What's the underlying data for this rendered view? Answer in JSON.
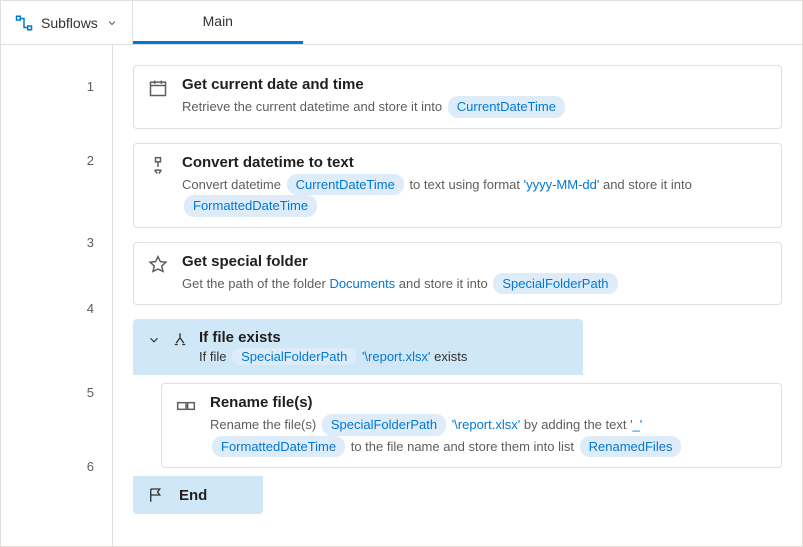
{
  "toolbar": {
    "subflows_label": "Subflows",
    "active_tab": "Main"
  },
  "lines": {
    "l1": "1",
    "l2": "2",
    "l3": "3",
    "l4": "4",
    "l5": "5",
    "l6": "6"
  },
  "actions": {
    "a1": {
      "title": "Get current date and time",
      "desc_pre": "Retrieve the current datetime and store it into ",
      "var1": "CurrentDateTime"
    },
    "a2": {
      "title": "Convert datetime to text",
      "d1": "Convert datetime ",
      "var1": "CurrentDateTime",
      "d2": " to text using format ",
      "fmt": "'yyyy-MM-dd'",
      "d3": " and store it into ",
      "var2": "FormattedDateTime"
    },
    "a3": {
      "title": "Get special folder",
      "d1": "Get the path of the folder ",
      "link": "Documents",
      "d2": " and store it into ",
      "var1": "SpecialFolderPath"
    },
    "ifh": {
      "title": "If file exists",
      "d1": "If file ",
      "var1": "SpecialFolderPath",
      "path": "'\\report.xlsx'",
      "d2": " exists"
    },
    "a5": {
      "title": "Rename file(s)",
      "d1": "Rename the file(s) ",
      "var1": "SpecialFolderPath",
      "path": "'\\report.xlsx'",
      "d2": " by adding the text ",
      "txt": "'_'",
      "var2": "FormattedDateTime",
      "d3": " to the file name and store them into list ",
      "var3": "RenamedFiles"
    },
    "end": {
      "title": "End"
    }
  }
}
